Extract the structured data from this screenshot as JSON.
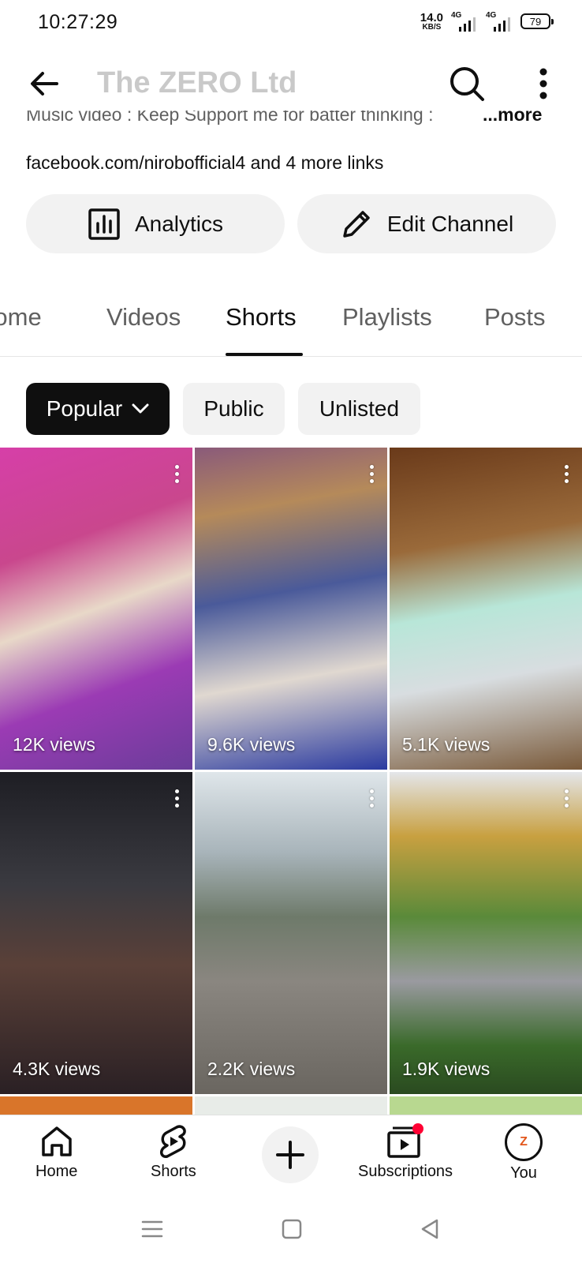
{
  "status_bar": {
    "time": "10:27:29",
    "net_speed": "14.0",
    "net_unit": "KB/S",
    "sim1": "4G",
    "sim2": "4G",
    "battery": "79"
  },
  "app_bar": {
    "title": "The ZERO Ltd",
    "back_icon": "arrow-left-icon",
    "search_icon": "search-icon",
    "more_icon": "more-vertical-icon"
  },
  "channel": {
    "description": "Music video : Keep Support me for batter thinking : ",
    "description_more": "...more",
    "links_main": "facebook.com/nirobofficial4",
    "links_more": " and 4 more links",
    "analytics_label": "Analytics",
    "edit_label": "Edit Channel"
  },
  "tabs": [
    {
      "label": "Home"
    },
    {
      "label": "Videos"
    },
    {
      "label": "Shorts"
    },
    {
      "label": "Playlists"
    },
    {
      "label": "Posts"
    }
  ],
  "active_tab": "Shorts",
  "chips": [
    {
      "label": "Popular"
    },
    {
      "label": "Public"
    },
    {
      "label": "Unlisted"
    }
  ],
  "shorts": [
    {
      "views": "12K views"
    },
    {
      "views": "9.6K views"
    },
    {
      "views": "5.1K views"
    },
    {
      "views": "4.3K views"
    },
    {
      "views": "2.2K views"
    },
    {
      "views": "1.9K views"
    }
  ],
  "bottom_nav": {
    "home": "Home",
    "shorts": "Shorts",
    "subscriptions": "Subscriptions",
    "you": "You",
    "avatar_letter": "Z"
  },
  "colors": {
    "accent_red": "#ff0033",
    "chip_active_bg": "#0f0f0f",
    "chip_bg": "#f2f2f2"
  }
}
